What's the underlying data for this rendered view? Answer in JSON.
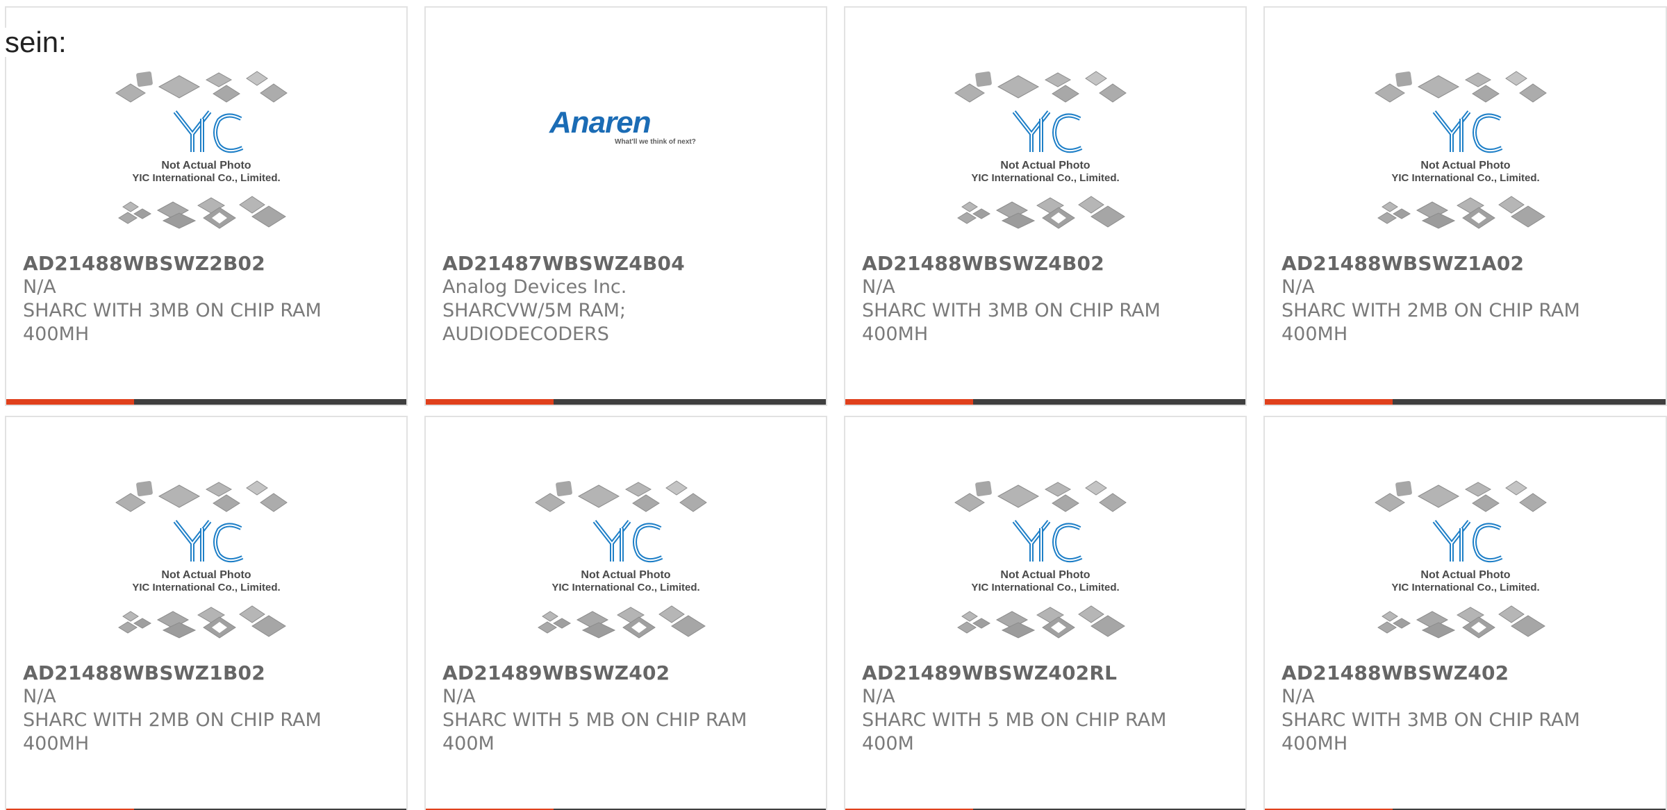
{
  "lead_text": "sein:",
  "colors": {
    "accent": "#e0401c",
    "bar": "#3f3f3f",
    "yic_blue": "#1e7fc7",
    "anaren_blue": "#1b6cb5"
  },
  "yic_photo": {
    "line1": "Not Actual Photo",
    "line2": "YIC International Co., Limited."
  },
  "anaren_logo": {
    "brand": "Anaren",
    "tagline": "What'll we think of next?"
  },
  "products": [
    {
      "part": "AD21488WBSWZ2B02",
      "maker": "N/A",
      "desc1": "SHARC WITH 3MB ON CHIP RAM",
      "desc2": "400MH",
      "image": "yic-placeholder"
    },
    {
      "part": "AD21487WBSWZ4B04",
      "maker": "Analog Devices Inc.",
      "desc1": "SHARCVW/5M RAM;",
      "desc2": "AUDIODECODERS",
      "image": "anaren-logo"
    },
    {
      "part": "AD21488WBSWZ4B02",
      "maker": "N/A",
      "desc1": "SHARC WITH 3MB ON CHIP RAM",
      "desc2": "400MH",
      "image": "yic-placeholder"
    },
    {
      "part": "AD21488WBSWZ1A02",
      "maker": "N/A",
      "desc1": "SHARC WITH 2MB ON CHIP RAM",
      "desc2": "400MH",
      "image": "yic-placeholder"
    },
    {
      "part": "AD21488WBSWZ1B02",
      "maker": "N/A",
      "desc1": "SHARC WITH 2MB ON CHIP RAM",
      "desc2": "400MH",
      "image": "yic-placeholder"
    },
    {
      "part": "AD21489WBSWZ402",
      "maker": "N/A",
      "desc1": "SHARC WITH 5 MB ON CHIP RAM",
      "desc2": "400M",
      "image": "yic-placeholder"
    },
    {
      "part": "AD21489WBSWZ402RL",
      "maker": "N/A",
      "desc1": "SHARC WITH 5 MB ON CHIP RAM",
      "desc2": "400M",
      "image": "yic-placeholder"
    },
    {
      "part": "AD21488WBSWZ402",
      "maker": "N/A",
      "desc1": "SHARC WITH 3MB ON CHIP RAM",
      "desc2": "400MH",
      "image": "yic-placeholder"
    }
  ]
}
